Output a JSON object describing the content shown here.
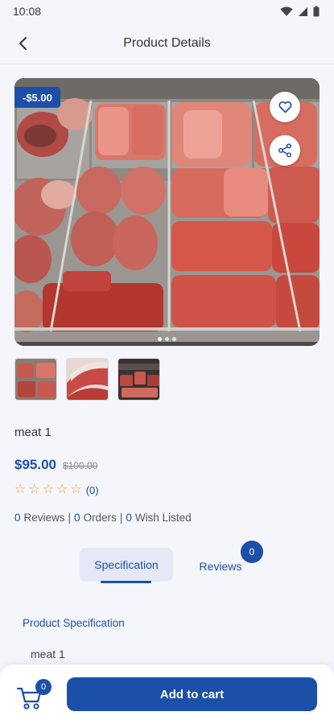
{
  "status_bar": {
    "time": "10:08",
    "icons": [
      "wifi-icon",
      "signal-icon",
      "battery-icon"
    ]
  },
  "app_bar": {
    "title": "Product Details",
    "back_icon": "back-arrow-icon"
  },
  "product": {
    "discount_badge": "-$5.00",
    "name": "meat 1",
    "price": "$95.00",
    "old_price": "$100.00",
    "rating_stars": 0,
    "rating_max": 5,
    "rating_count": "(0)",
    "image_count": 3,
    "active_image": 1
  },
  "stats": {
    "reviews_num": "0",
    "reviews_label": "Reviews",
    "orders_num": "0",
    "orders_label": "Orders",
    "wish_num": "0",
    "wish_label": "Wish Listed",
    "separator": "|"
  },
  "tabs": {
    "specification_label": "Specification",
    "reviews_label": "Reviews",
    "reviews_badge": "0",
    "active": "Specification"
  },
  "specification": {
    "heading": "Product Specification",
    "text": "meat 1"
  },
  "bottom_bar": {
    "cart_badge": "0",
    "add_to_cart_label": "Add to cart"
  },
  "colors": {
    "accent": "#1b4fa8",
    "star": "#f0a030",
    "background": "#f4f6fb"
  }
}
